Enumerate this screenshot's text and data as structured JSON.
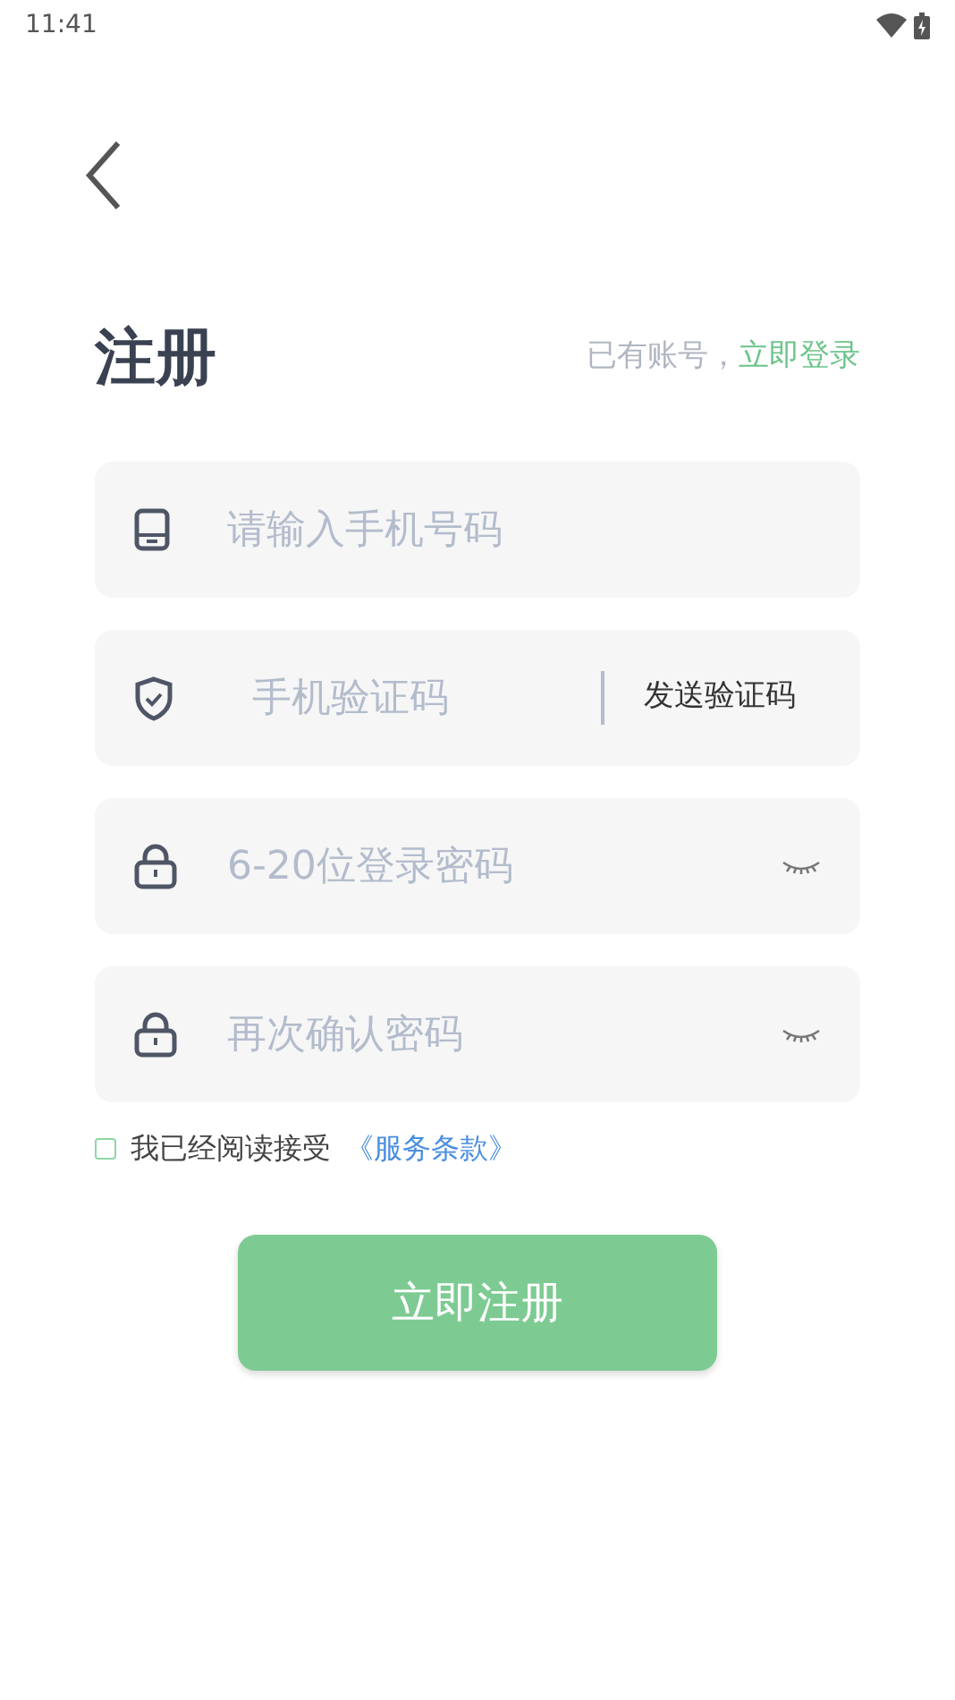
{
  "status_bar": {
    "time": "11:41"
  },
  "header": {
    "title": "注册",
    "prompt": "已有账号，",
    "login_link": "立即登录"
  },
  "fields": [
    {
      "kind": "phone",
      "placeholder": "请输入手机号码"
    },
    {
      "kind": "code",
      "placeholder": "手机验证码",
      "action": "发送验证码"
    },
    {
      "kind": "password",
      "placeholder": "6-20位登录密码"
    },
    {
      "kind": "password",
      "placeholder": "再次确认密码"
    }
  ],
  "agreement": {
    "checked": false,
    "text": "我已经阅读接受",
    "link": "《服务条款》"
  },
  "submit": {
    "label": "立即注册"
  }
}
